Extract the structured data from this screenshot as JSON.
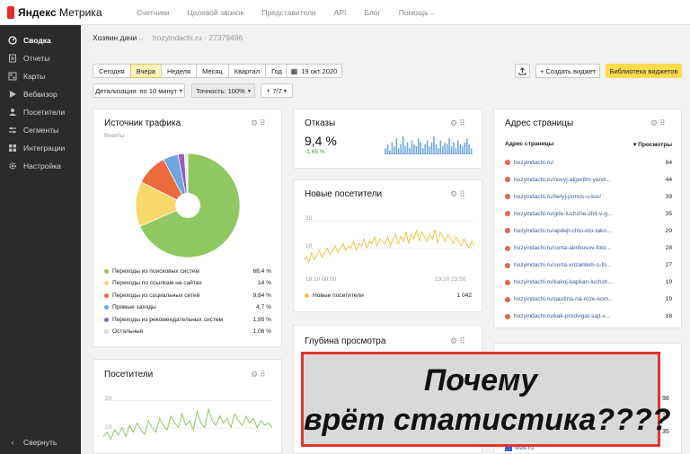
{
  "header": {
    "logo_brand": "Яндекс",
    "logo_product": "Метрика",
    "nav": [
      {
        "label": "Счетчики"
      },
      {
        "label": "Целевой звонок"
      },
      {
        "label": "Представители"
      },
      {
        "label": "API"
      },
      {
        "label": "Блог"
      },
      {
        "label": "Помощь"
      }
    ]
  },
  "sidebar": {
    "items": [
      {
        "label": "Сводка",
        "icon": "gauge-icon"
      },
      {
        "label": "Отчеты",
        "icon": "reports-icon"
      },
      {
        "label": "Карты",
        "icon": "map-icon"
      },
      {
        "label": "Вебвизор",
        "icon": "play-icon"
      },
      {
        "label": "Посетители",
        "icon": "user-icon"
      },
      {
        "label": "Сегменты",
        "icon": "segments-icon"
      },
      {
        "label": "Интеграции",
        "icon": "integrations-icon"
      },
      {
        "label": "Настройка",
        "icon": "gear-icon"
      }
    ],
    "collapse_label": "Свернуть"
  },
  "counter": {
    "owner": "Хозяин дачи",
    "site": "hozyindachi.ru · 27379496"
  },
  "toolbar": {
    "periods": [
      "Сегодня",
      "Вчера",
      "Неделя",
      "Месяц",
      "Квартал",
      "Год"
    ],
    "selected_period": "Вчера",
    "date": "19 окт 2020",
    "detail": "Детализация: по 10 минут",
    "accuracy": "Точность: 100%",
    "segments": "7/7",
    "create_widget": "+ Создать виджет",
    "widget_library": "Библиотека виджетов"
  },
  "traffic_card": {
    "title": "Источник трафика",
    "subtitle": "Визиты",
    "legend": [
      {
        "label": "Переходы из поисковых систем",
        "value": "68,4 %",
        "color": "#8fc760"
      },
      {
        "label": "Переходы по ссылкам на сайтах",
        "value": "14 %",
        "color": "#f7d86a"
      },
      {
        "label": "Переходы из социальных сетей",
        "value": "9,84 %",
        "color": "#ec6a3c"
      },
      {
        "label": "Прямые заходы",
        "value": "4,7 %",
        "color": "#6fa6dd"
      },
      {
        "label": "Переходы из рекомендательных систем",
        "value": "1,95 %",
        "color": "#9b59c3"
      },
      {
        "label": "Остальные",
        "value": "1,06 %",
        "color": "#eeeeee"
      }
    ]
  },
  "bounce_card": {
    "title": "Отказы",
    "value": "9,4 %",
    "change": "-1,65 %"
  },
  "new_visitors_card": {
    "title": "Новые посетители",
    "y_top": "20",
    "y_mid": "10",
    "x_start": "19.10 00:00",
    "x_end": "19.10 23:50",
    "legend_label": "Новые посетители",
    "legend_value": "1 042"
  },
  "depth_card": {
    "title": "Глубина просмотра"
  },
  "visitors_card": {
    "title": "Посетители",
    "y_top": "20",
    "y_mid": "10"
  },
  "pages_card": {
    "title": "Адрес страницы",
    "col_page": "Адрес страницы",
    "col_views": "▾ Просмотры",
    "rows": [
      {
        "url": "hozyindachi.ru/",
        "views": "84"
      },
      {
        "url": "hozyindachi.ru/novyj-algoritm-yand...",
        "views": "44"
      },
      {
        "url": "hozyindachi.ru/belyj-ponos-u-kur/",
        "views": "39"
      },
      {
        "url": "hozyindachi.ru/gde-luchshe-zhit-v-g...",
        "views": "35"
      },
      {
        "url": "hozyindachi.ru/apdejt-chto-eto-tako...",
        "views": "29"
      },
      {
        "url": "hozyindachi.ru/sorta-abrikosov-foto...",
        "views": "28"
      },
      {
        "url": "hozyindachi.ru/sorta-xrizantem-s-fo...",
        "views": "27"
      },
      {
        "url": "hozyindachi.ru/kakoj-kapkan-luchsh...",
        "views": "19"
      },
      {
        "url": "hozyindachi.ru/pautina-na-roze-kom...",
        "views": "19"
      },
      {
        "url": "hozyindachi.ru/kak-prodvigat-sajt-v...",
        "views": "18"
      }
    ]
  },
  "search_card": {
    "partial_values": [
      "98",
      "14",
      "35"
    ],
    "mail_label": "Mail.ru"
  },
  "banner": {
    "line1": "Почему",
    "line2": "врёт статистика????"
  },
  "chart_data": [
    {
      "type": "pie",
      "title": "Источник трафика",
      "categories": [
        "Переходы из поисковых систем",
        "Переходы по ссылкам на сайтах",
        "Переходы из социальных сетей",
        "Прямые заходы",
        "Переходы из рекомендательных систем",
        "Остальные"
      ],
      "values": [
        68.4,
        14,
        9.84,
        4.7,
        1.95,
        1.06
      ],
      "colors": [
        "#8fc760",
        "#f7d86a",
        "#ec6a3c",
        "#6fa6dd",
        "#9b59c3",
        "#eeeeee"
      ],
      "donut": true
    },
    {
      "type": "bar",
      "title": "Отказы",
      "color": "#6fa6dd",
      "values": [
        3,
        5,
        2,
        6,
        4,
        8,
        3,
        5,
        9,
        4,
        6,
        3,
        7,
        5,
        4,
        8,
        6,
        3,
        5,
        7,
        4,
        6,
        9,
        5,
        3,
        7,
        4,
        6,
        5,
        8,
        4,
        6,
        3,
        7,
        5,
        4,
        6,
        8,
        5,
        3
      ]
    },
    {
      "type": "line",
      "title": "Новые посетители",
      "color": "#f3c44a",
      "ylim": [
        0,
        22
      ],
      "values": [
        5,
        6,
        4,
        8,
        5,
        7,
        9,
        6,
        8,
        10,
        7,
        9,
        11,
        8,
        10,
        12,
        9,
        11,
        10,
        13,
        9,
        12,
        11,
        14,
        10,
        13,
        12,
        15,
        11,
        14,
        13,
        12,
        15,
        11,
        14,
        16,
        12,
        15,
        13,
        17,
        12,
        16,
        14,
        18,
        13,
        17,
        15,
        13,
        16,
        14,
        18,
        12,
        17,
        15,
        13,
        16,
        14,
        12,
        15,
        13,
        11,
        14,
        12,
        10,
        13,
        11
      ]
    },
    {
      "type": "line",
      "title": "Посетители",
      "color": "#8fc760",
      "ylim": [
        0,
        22
      ],
      "values": [
        6,
        8,
        5,
        9,
        7,
        10,
        6,
        11,
        8,
        12,
        9,
        7,
        13,
        10,
        8,
        14,
        11,
        9,
        15,
        12,
        10,
        16,
        11,
        13,
        9,
        17,
        12,
        10,
        18,
        13,
        11,
        15,
        12,
        14,
        10,
        16,
        13,
        11,
        15,
        12,
        14,
        10,
        13,
        11,
        12,
        10
      ]
    }
  ]
}
